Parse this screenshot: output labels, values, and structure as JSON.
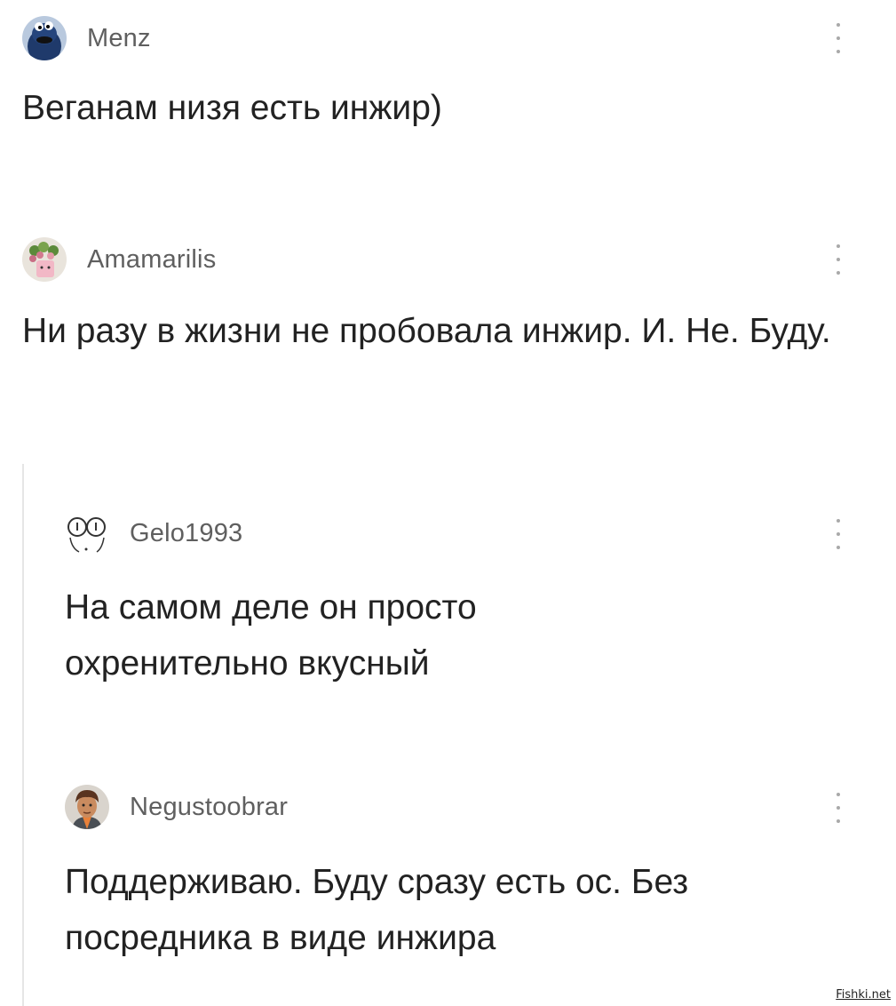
{
  "comments": [
    {
      "username": "Menz",
      "avatar_icon": "cookie-monster-avatar",
      "text": "Веганам низя есть инжир)"
    },
    {
      "username": "Amamarilis",
      "avatar_icon": "flower-pot-avatar",
      "text": "Ни разу в жизни не пробовала инжир. И. Не. Буду."
    },
    {
      "username": "Gelo1993",
      "avatar_icon": "glasses-face-avatar",
      "text": "На самом деле он просто охренительно вкусный"
    },
    {
      "username": "Negustoobrar",
      "avatar_icon": "cartoon-man-avatar",
      "text": "Поддерживаю. Буду сразу есть ос. Без посредника в виде инжира"
    }
  ],
  "menu_icon": "more-vertical-icon",
  "watermark": "Fishki.net"
}
